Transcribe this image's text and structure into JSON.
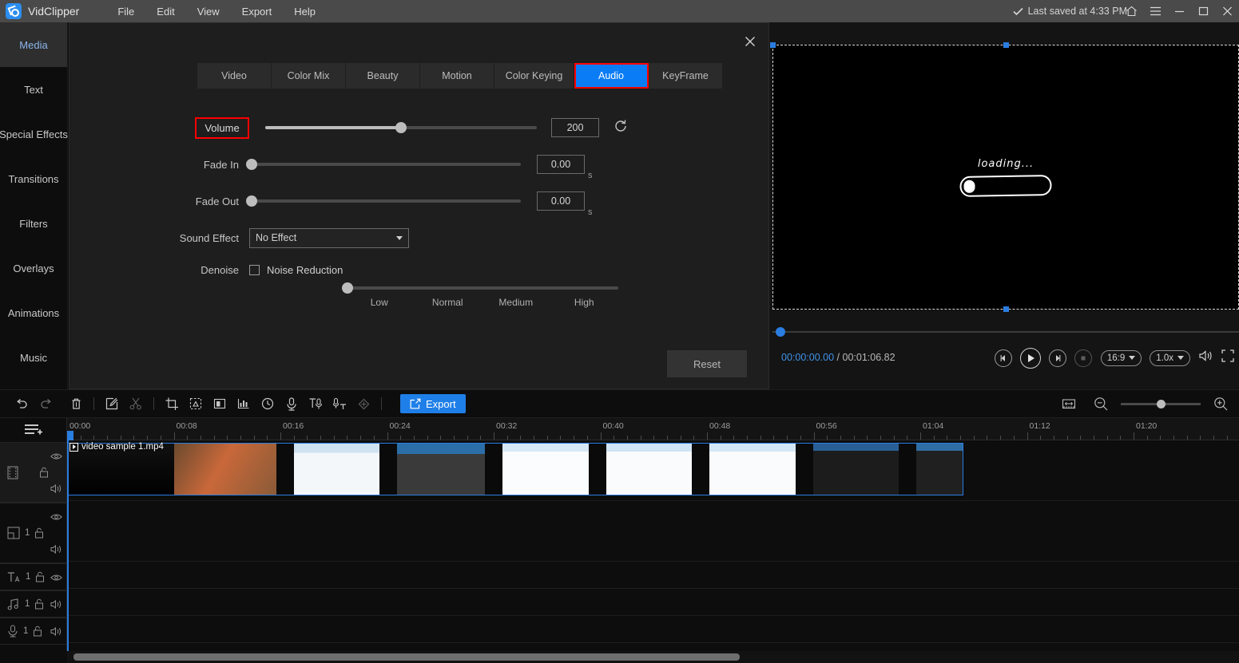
{
  "titlebar": {
    "app_name": "VidClipper",
    "menus": [
      "File",
      "Edit",
      "View",
      "Export",
      "Help"
    ],
    "saved_status": "Last saved at 4:33 PM",
    "check_icon": "check-icon",
    "window_buttons": [
      "home-icon",
      "hamburger-menu-icon",
      "minimize-icon",
      "maximize-icon",
      "close-icon"
    ]
  },
  "sidebar": {
    "items": [
      {
        "label": "Media",
        "active": true
      },
      {
        "label": "Text",
        "active": false
      },
      {
        "label": "Special Effects",
        "active": false
      },
      {
        "label": "Transitions",
        "active": false
      },
      {
        "label": "Filters",
        "active": false
      },
      {
        "label": "Overlays",
        "active": false
      },
      {
        "label": "Animations",
        "active": false
      },
      {
        "label": "Music",
        "active": false
      }
    ]
  },
  "dialog": {
    "close_label": "×",
    "tabs": [
      {
        "label": "Video",
        "active": false
      },
      {
        "label": "Color Mix",
        "active": false
      },
      {
        "label": "Beauty",
        "active": false
      },
      {
        "label": "Motion",
        "active": false
      },
      {
        "label": "Color Keying",
        "active": false
      },
      {
        "label": "Audio",
        "active": true
      },
      {
        "label": "KeyFrame",
        "active": false
      }
    ],
    "volume": {
      "label": "Volume",
      "value": "200",
      "slider_percent": 50,
      "reset_icon": "reset-circular-arrow-icon"
    },
    "fade_in": {
      "label": "Fade In",
      "value": "0.00",
      "unit": "s",
      "slider_percent": 0
    },
    "fade_out": {
      "label": "Fade Out",
      "value": "0.00",
      "unit": "s",
      "slider_percent": 0
    },
    "sound_effect": {
      "label": "Sound Effect",
      "selected": "No Effect"
    },
    "denoise": {
      "label": "Denoise",
      "checkbox_label": "Noise Reduction",
      "checked": false,
      "slider_percent": 0,
      "scale": [
        "Low",
        "Normal",
        "Medium",
        "High"
      ]
    },
    "reset_button": "Reset"
  },
  "preview": {
    "artwork_text": "loading...",
    "current_time": "00:00:00.00",
    "separator": "/",
    "total_time": "00:01:06.82",
    "controls": [
      "prev-frame-icon",
      "play-icon",
      "next-frame-icon",
      "stop-icon"
    ],
    "aspect_ratio": "16:9",
    "playback_speed": "1.0x",
    "volume_icon": "speaker-icon",
    "fullscreen_icon": "fullscreen-icon"
  },
  "toolbar": {
    "icons": [
      "undo-icon",
      "redo-icon",
      "delete-icon",
      "edit-icon",
      "scissors-icon",
      "crop-icon",
      "mask-icon",
      "freeze-frame-icon",
      "audio-levels-icon",
      "speed-clock-icon",
      "record-mic-icon",
      "text-to-speech-icon",
      "speech-to-text-icon",
      "keyframe-diamond-icon"
    ],
    "export_label": "Export",
    "export_icon": "export-share-icon",
    "fit-timeline_icon": "fit-timeline-icon",
    "zoom_out_icon": "zoom-out-icon",
    "zoom_in_icon": "zoom-in-icon",
    "zoom_percent": 45
  },
  "timeline": {
    "add_track_icon": "add-track-icon",
    "ruler_labels": [
      "00:00",
      "00:08",
      "00:16",
      "00:24",
      "00:32",
      "00:40",
      "00:48",
      "00:56",
      "01:04",
      "01:12",
      "01:20"
    ],
    "tracks": [
      {
        "icon": "video-track-icon",
        "count": "",
        "lock": "unlock-icon",
        "eye": "eye-icon",
        "speaker": "speaker-icon"
      },
      {
        "icon": "pip-track-icon",
        "count": "1",
        "lock": "unlock-icon",
        "eye": "eye-icon",
        "speaker": "speaker-icon"
      },
      {
        "icon": "text-track-icon",
        "count": "1",
        "lock": "unlock-icon",
        "eye": "eye-icon",
        "speaker": ""
      },
      {
        "icon": "music-track-icon",
        "count": "1",
        "lock": "unlock-icon",
        "eye": "",
        "speaker": "speaker-icon"
      },
      {
        "icon": "voiceover-track-icon",
        "count": "1",
        "lock": "unlock-icon",
        "eye": "",
        "speaker": "speaker-icon"
      }
    ],
    "clip": {
      "name": "video sample 1.mp4"
    }
  }
}
